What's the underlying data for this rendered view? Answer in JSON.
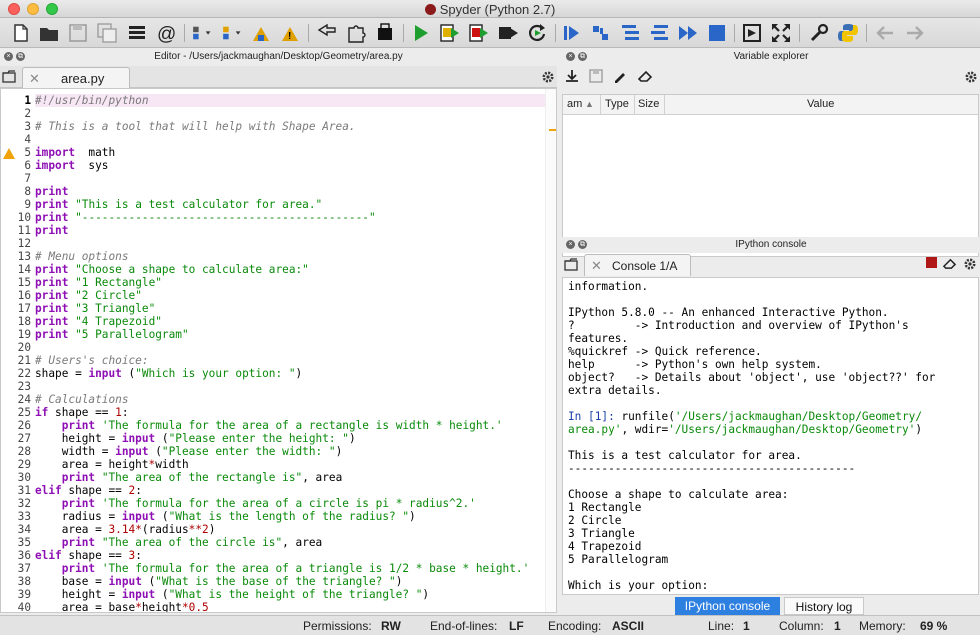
{
  "window": {
    "title": "Spyder (Python 2.7)"
  },
  "toolbar": {
    "icons": [
      "new-file-icon",
      "open-folder-icon",
      "save-icon",
      "save-all-icon",
      "list-icon",
      "at-icon",
      "run-menu-icon",
      "debug-menu-icon",
      "tools-icon",
      "warning-tool-icon",
      "arrow-tool-icon",
      "code-tool-icon",
      "run-icon",
      "run-cell-icon",
      "run-cell-advance-icon",
      "run-selection-icon",
      "rerun-icon",
      "debug-icon",
      "step-icon",
      "step-into-icon",
      "step-return-icon",
      "continue-icon",
      "stop-icon",
      "maximize-icon",
      "fullscreen-icon",
      "wrench-icon",
      "python-icon",
      "back-icon",
      "forward-icon"
    ]
  },
  "editor": {
    "header_title": "Editor - /Users/jackmaughan/Desktop/Geometry/area.py",
    "tab_label": "area.py",
    "lines": [
      {
        "n": "1",
        "s": [
          [
            "cm",
            "#!/usr/bin/python"
          ]
        ]
      },
      {
        "n": "2",
        "s": []
      },
      {
        "n": "3",
        "s": [
          [
            "cm",
            "# This is a tool that will help with Shape Area."
          ]
        ]
      },
      {
        "n": "4",
        "s": []
      },
      {
        "n": "5",
        "s": [
          [
            "kw",
            "import"
          ],
          [
            "",
            "  math"
          ]
        ]
      },
      {
        "n": "6",
        "s": [
          [
            "kw",
            "import"
          ],
          [
            "",
            "  sys"
          ]
        ]
      },
      {
        "n": "7",
        "s": []
      },
      {
        "n": "8",
        "s": [
          [
            "kw",
            "print"
          ]
        ]
      },
      {
        "n": "9",
        "s": [
          [
            "kw",
            "print"
          ],
          [
            "",
            " "
          ],
          [
            "str",
            "\"This is a test calculator for area.\""
          ]
        ]
      },
      {
        "n": "10",
        "s": [
          [
            "kw",
            "print"
          ],
          [
            "",
            " "
          ],
          [
            "str",
            "\"-------------------------------------------\""
          ]
        ]
      },
      {
        "n": "11",
        "s": [
          [
            "kw",
            "print"
          ]
        ]
      },
      {
        "n": "12",
        "s": []
      },
      {
        "n": "13",
        "s": [
          [
            "cm",
            "# Menu options"
          ]
        ]
      },
      {
        "n": "14",
        "s": [
          [
            "kw",
            "print"
          ],
          [
            "",
            " "
          ],
          [
            "str",
            "\"Choose a shape to calculate area:\""
          ]
        ]
      },
      {
        "n": "15",
        "s": [
          [
            "kw",
            "print"
          ],
          [
            "",
            " "
          ],
          [
            "str",
            "\"1 Rectangle\""
          ]
        ]
      },
      {
        "n": "16",
        "s": [
          [
            "kw",
            "print"
          ],
          [
            "",
            " "
          ],
          [
            "str",
            "\"2 Circle\""
          ]
        ]
      },
      {
        "n": "17",
        "s": [
          [
            "kw",
            "print"
          ],
          [
            "",
            " "
          ],
          [
            "str",
            "\"3 Triangle\""
          ]
        ]
      },
      {
        "n": "18",
        "s": [
          [
            "kw",
            "print"
          ],
          [
            "",
            " "
          ],
          [
            "str",
            "\"4 Trapezoid\""
          ]
        ]
      },
      {
        "n": "19",
        "s": [
          [
            "kw",
            "print"
          ],
          [
            "",
            " "
          ],
          [
            "str",
            "\"5 Parallelogram\""
          ]
        ]
      },
      {
        "n": "20",
        "s": []
      },
      {
        "n": "21",
        "s": [
          [
            "cm",
            "# Users's choice:"
          ]
        ]
      },
      {
        "n": "22",
        "s": [
          [
            "",
            "shape = "
          ],
          [
            "kw",
            "input"
          ],
          [
            "",
            " ("
          ],
          [
            "str",
            "\"Which is your option: \""
          ],
          [
            "",
            ")"
          ]
        ]
      },
      {
        "n": "23",
        "s": []
      },
      {
        "n": "24",
        "s": [
          [
            "cm",
            "# Calculations"
          ]
        ]
      },
      {
        "n": "25",
        "s": [
          [
            "kw",
            "if"
          ],
          [
            "",
            " shape == "
          ],
          [
            "num",
            "1"
          ],
          [
            "",
            ":"
          ]
        ]
      },
      {
        "n": "26",
        "s": [
          [
            "",
            "    "
          ],
          [
            "kw",
            "print"
          ],
          [
            "",
            " "
          ],
          [
            "str",
            "'The formula for the area of a rectangle is width * height.'"
          ]
        ]
      },
      {
        "n": "27",
        "s": [
          [
            "",
            "    height = "
          ],
          [
            "kw",
            "input"
          ],
          [
            "",
            " ("
          ],
          [
            "str",
            "\"Please enter the height: \""
          ],
          [
            "",
            ")"
          ]
        ]
      },
      {
        "n": "28",
        "s": [
          [
            "",
            "    width = "
          ],
          [
            "kw",
            "input"
          ],
          [
            "",
            " ("
          ],
          [
            "str",
            "\"Please enter the width: \""
          ],
          [
            "",
            ")"
          ]
        ]
      },
      {
        "n": "29",
        "s": [
          [
            "",
            "    area = height"
          ],
          [
            "op",
            "*"
          ],
          [
            "",
            "width"
          ]
        ]
      },
      {
        "n": "30",
        "s": [
          [
            "",
            "    "
          ],
          [
            "kw",
            "print"
          ],
          [
            "",
            " "
          ],
          [
            "str",
            "\"The area of the rectangle is\""
          ],
          [
            "",
            ", area"
          ]
        ]
      },
      {
        "n": "31",
        "s": [
          [
            "kw",
            "elif"
          ],
          [
            "",
            " shape == "
          ],
          [
            "num",
            "2"
          ],
          [
            "",
            ":"
          ]
        ]
      },
      {
        "n": "32",
        "s": [
          [
            "",
            "    "
          ],
          [
            "kw",
            "print"
          ],
          [
            "",
            " "
          ],
          [
            "str",
            "'The formula for the area of a circle is pi * radius^2.'"
          ]
        ]
      },
      {
        "n": "33",
        "s": [
          [
            "",
            "    radius = "
          ],
          [
            "kw",
            "input"
          ],
          [
            "",
            " ("
          ],
          [
            "str",
            "\"What is the length of the radius? \""
          ],
          [
            "",
            ")"
          ]
        ]
      },
      {
        "n": "34",
        "s": [
          [
            "",
            "    area = "
          ],
          [
            "num",
            "3.14"
          ],
          [
            "op",
            "*"
          ],
          [
            "",
            "(radius"
          ],
          [
            "op",
            "**"
          ],
          [
            "num",
            "2"
          ],
          [
            "",
            ")"
          ]
        ]
      },
      {
        "n": "35",
        "s": [
          [
            "",
            "    "
          ],
          [
            "kw",
            "print"
          ],
          [
            "",
            " "
          ],
          [
            "str",
            "\"The area of the circle is\""
          ],
          [
            "",
            ", area"
          ]
        ]
      },
      {
        "n": "36",
        "s": [
          [
            "kw",
            "elif"
          ],
          [
            "",
            " shape == "
          ],
          [
            "num",
            "3"
          ],
          [
            "",
            ":"
          ]
        ]
      },
      {
        "n": "37",
        "s": [
          [
            "",
            "    "
          ],
          [
            "kw",
            "print"
          ],
          [
            "",
            " "
          ],
          [
            "str",
            "'The formula for the area of a triangle is 1/2 * base * height.'"
          ]
        ]
      },
      {
        "n": "38",
        "s": [
          [
            "",
            "    base = "
          ],
          [
            "kw",
            "input"
          ],
          [
            "",
            " ("
          ],
          [
            "str",
            "\"What is the base of the triangle? \""
          ],
          [
            "",
            ")"
          ]
        ]
      },
      {
        "n": "39",
        "s": [
          [
            "",
            "    height = "
          ],
          [
            "kw",
            "input"
          ],
          [
            "",
            " ("
          ],
          [
            "str",
            "\"What is the height of the triangle? \""
          ],
          [
            "",
            ")"
          ]
        ]
      },
      {
        "n": "40",
        "s": [
          [
            "",
            "    area = base"
          ],
          [
            "op",
            "*"
          ],
          [
            "",
            "height"
          ],
          [
            "op",
            "*"
          ],
          [
            "num",
            "0.5"
          ]
        ]
      }
    ]
  },
  "variable_explorer": {
    "header_title": "Variable explorer",
    "columns": [
      "am",
      "Type",
      "Size",
      "Value"
    ],
    "sort_indicator": "▲"
  },
  "console": {
    "header_title": "IPython console",
    "tab_label": "Console 1/A",
    "lines": [
      [
        [
          "",
          "information."
        ]
      ],
      [],
      [
        [
          "",
          "IPython 5.8.0 -- An enhanced Interactive Python."
        ]
      ],
      [
        [
          "",
          "?         -> Introduction and overview of IPython's"
        ]
      ],
      [
        [
          "",
          "features."
        ]
      ],
      [
        [
          "",
          "%quickref -> Quick reference."
        ]
      ],
      [
        [
          "",
          "help      -> Python's own help system."
        ]
      ],
      [
        [
          "",
          "object?   -> Details about 'object', use 'object??' for"
        ]
      ],
      [
        [
          "",
          "extra details."
        ]
      ],
      [],
      [
        [
          "prompt",
          "In [1]: "
        ],
        [
          "",
          "runfile("
        ],
        [
          "path",
          "'/Users/jackmaughan/Desktop/Geometry/"
        ]
      ],
      [
        [
          "path",
          "area.py'"
        ],
        [
          "",
          ", wdir="
        ],
        [
          "path",
          "'/Users/jackmaughan/Desktop/Geometry'"
        ],
        [
          "",
          ")"
        ]
      ],
      [],
      [
        [
          "",
          "This is a test calculator for area."
        ]
      ],
      [
        [
          "",
          "-------------------------------------------"
        ]
      ],
      [],
      [
        [
          "",
          "Choose a shape to calculate area:"
        ]
      ],
      [
        [
          "",
          "1 Rectangle"
        ]
      ],
      [
        [
          "",
          "2 Circle"
        ]
      ],
      [
        [
          "",
          "3 Triangle"
        ]
      ],
      [
        [
          "",
          "4 Trapezoid"
        ]
      ],
      [
        [
          "",
          "5 Parallelogram"
        ]
      ],
      [],
      [
        [
          "",
          "Which is your option:"
        ]
      ]
    ],
    "bottom_tabs": [
      "IPython console",
      "History log"
    ]
  },
  "status": {
    "permissions_label": "Permissions:",
    "permissions_value": "RW",
    "eol_label": "End-of-lines:",
    "eol_value": "LF",
    "encoding_label": "Encoding:",
    "encoding_value": "ASCII",
    "line_label": "Line:",
    "line_value": "1",
    "column_label": "Column:",
    "column_value": "1",
    "memory_label": "Memory:",
    "memory_value": "69 %"
  },
  "colors": {
    "accent": "#2d7fe0",
    "keyword": "#8e0fb4",
    "string": "#0a8a0a",
    "comment": "#7a7a7a",
    "number": "#ae0000",
    "run_green": "#1e9e2e",
    "debug_blue": "#2a66c7",
    "stop_red": "#b01818"
  }
}
